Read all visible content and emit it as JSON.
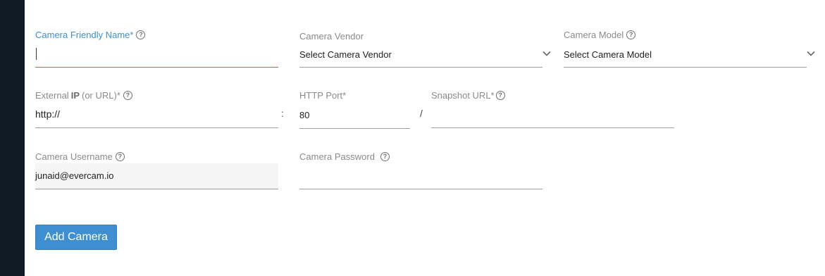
{
  "form": {
    "camera_name": {
      "label": "Camera Friendly Name*",
      "value": ""
    },
    "camera_vendor": {
      "label": "Camera Vendor",
      "selected": "Select Camera Vendor"
    },
    "camera_model": {
      "label": "Camera Model",
      "selected": "Select Camera Model"
    },
    "external_ip": {
      "label_prefix": "External",
      "label_bold": "IP",
      "label_suffix": "(or URL)*",
      "value": "http://"
    },
    "http_port": {
      "label": "HTTP Port*",
      "value": "80"
    },
    "snapshot_url": {
      "label": "Snapshot URL*",
      "value": ""
    },
    "username": {
      "label": "Camera Username",
      "value": "junaid@evercam.io"
    },
    "password": {
      "label": "Camera Password",
      "value": ""
    },
    "colon_separator": ":",
    "slash_separator": "/"
  },
  "actions": {
    "add_camera_label": "Add Camera"
  },
  "icons": {
    "help": "?"
  },
  "colors": {
    "accent": "#3d8fd1",
    "error": "#d9534f",
    "sidebar": "#0f1c24"
  }
}
